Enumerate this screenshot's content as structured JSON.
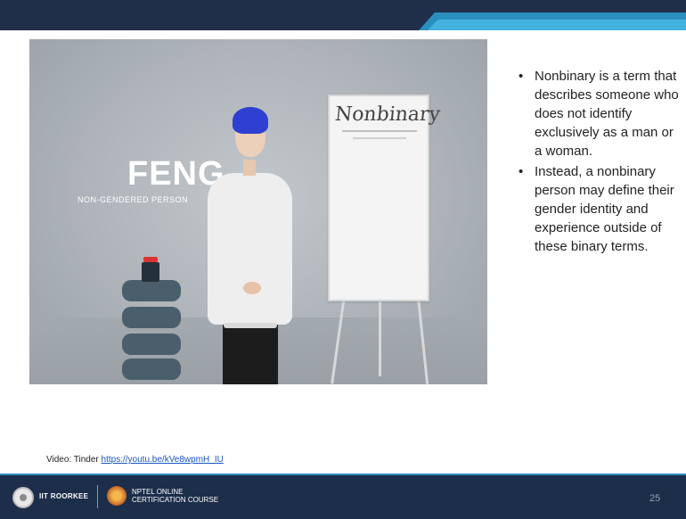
{
  "video": {
    "name": "FENG",
    "subtitle": "NON-GENDERED PERSON",
    "board_title": "Nonbinary"
  },
  "bullets": [
    "Nonbinary is a term that describes someone who does not identify exclusively as a man or a woman.",
    "Instead, a nonbinary person may define their gender identity and experience outside of these binary terms."
  ],
  "credit": {
    "label": "Video: Tinder ",
    "link_text": "https://youtu.be/kVe8wpmH_IU"
  },
  "footer": {
    "institute": "IIT ROORKEE",
    "nptel_line1": "NPTEL ONLINE",
    "nptel_line2": "CERTIFICATION COURSE",
    "page_number": "25"
  },
  "colors": {
    "header_navy": "#1f2f4a",
    "accent_blue": "#2a8fbf",
    "hair_blue": "#2f3fd2",
    "link_blue": "#1a55c0"
  },
  "icons": [
    "iit-roorkee-logo-icon",
    "nptel-logo-icon"
  ]
}
